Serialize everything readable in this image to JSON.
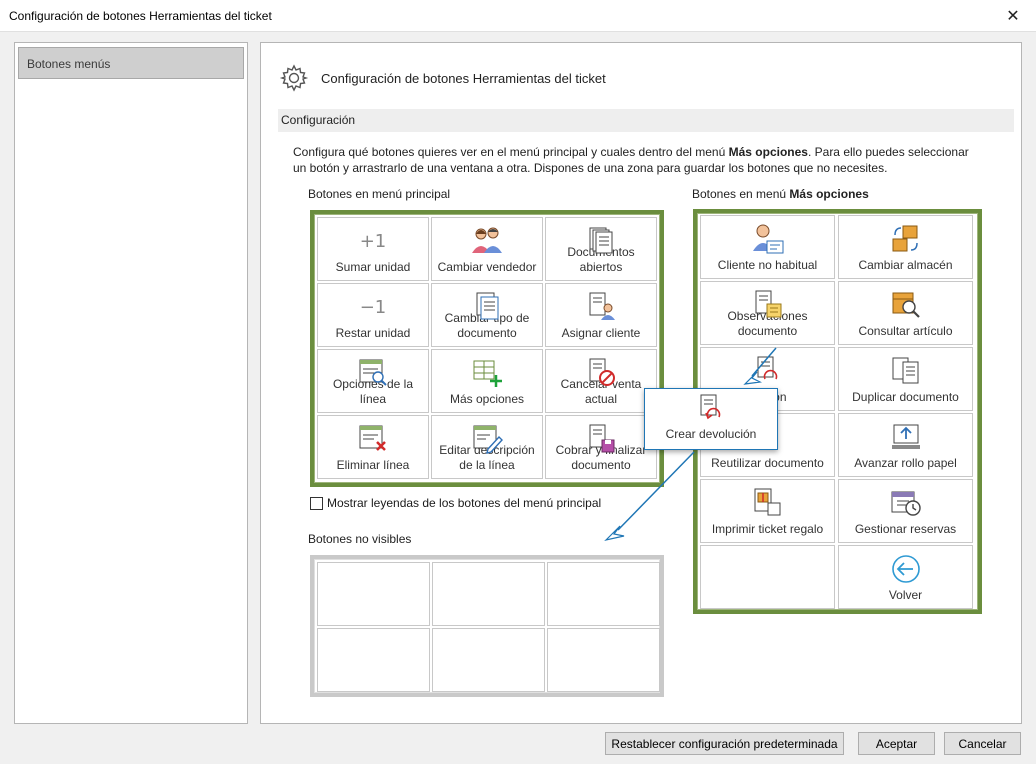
{
  "window": {
    "title": "Configuración de botones Herramientas del ticket",
    "close_glyph": "✕"
  },
  "sidebar": {
    "items": [
      {
        "label": "Botones menús"
      }
    ]
  },
  "main": {
    "title": "Configuración de botones Herramientas del ticket",
    "section": "Configuración",
    "description_pre": "Configura qué botones quieres ver en el menú principal y cuales dentro del menú ",
    "description_bold": "Más opciones",
    "description_post": ". Para ello puedes seleccionar un botón y arrastrarlo de una ventana a otra. Dispones de una zona para guardar los botones que no necesites.",
    "main_menu_label": "Botones en menú principal",
    "more_menu_label_pre": "Botones en menú ",
    "more_menu_label_bold": "Más opciones",
    "hidden_label": "Botones no visibles",
    "checkbox_label": "Mostrar leyendas de los botones del menú principal",
    "checkbox_checked": false
  },
  "main_menu_buttons": [
    {
      "label": "Sumar unidad",
      "icon": "plus-one-icon",
      "glyph": "+1"
    },
    {
      "label": "Cambiar vendedor",
      "icon": "users-icon"
    },
    {
      "label": "Documentos abiertos",
      "icon": "documents-icon"
    },
    {
      "label": "Restar unidad",
      "icon": "minus-one-icon",
      "glyph": "−1"
    },
    {
      "label": "Cambiar tipo de documento",
      "icon": "document-type-icon"
    },
    {
      "label": "Asignar cliente",
      "icon": "assign-client-icon"
    },
    {
      "label": "Opciones de la línea",
      "icon": "line-options-icon"
    },
    {
      "label": "Más opciones",
      "icon": "more-options-icon"
    },
    {
      "label": "Cancelar venta actual",
      "icon": "cancel-sale-icon"
    },
    {
      "label": "Eliminar línea",
      "icon": "delete-line-icon"
    },
    {
      "label": "Editar descripción de la línea",
      "icon": "edit-description-icon"
    },
    {
      "label": "Cobrar y finalizar documento",
      "icon": "checkout-icon"
    }
  ],
  "more_menu_buttons": [
    {
      "label": "Cliente no habitual",
      "icon": "occasional-client-icon"
    },
    {
      "label": "Cambiar almacén",
      "icon": "warehouse-icon"
    },
    {
      "label": "Observaciones documento",
      "icon": "document-notes-icon"
    },
    {
      "label": "Consultar artículo",
      "icon": "search-article-icon"
    },
    {
      "label": "Crear devolución",
      "icon": "return-icon",
      "visible_text": "olución"
    },
    {
      "label": "Duplicar documento",
      "icon": "duplicate-icon"
    },
    {
      "label": "Reutilizar documento",
      "icon": "reuse-icon"
    },
    {
      "label": "Avanzar rollo papel",
      "icon": "paper-feed-icon"
    },
    {
      "label": "Imprimir ticket regalo",
      "icon": "gift-ticket-icon"
    },
    {
      "label": "Gestionar reservas",
      "icon": "reservations-icon"
    },
    {
      "label": "",
      "icon": ""
    },
    {
      "label": "Volver",
      "icon": "back-arrow-icon"
    }
  ],
  "drag_ghost": {
    "label": "Crear devolución",
    "icon": "return-icon"
  },
  "footer": {
    "reset_label": "Restablecer configuración predeterminada",
    "accept_label": "Aceptar",
    "cancel_label": "Cancelar"
  },
  "colors": {
    "frame_green": "#6b8e3e",
    "accent_blue": "#1f76b5",
    "sidebar_selected": "#cfcfcf"
  }
}
